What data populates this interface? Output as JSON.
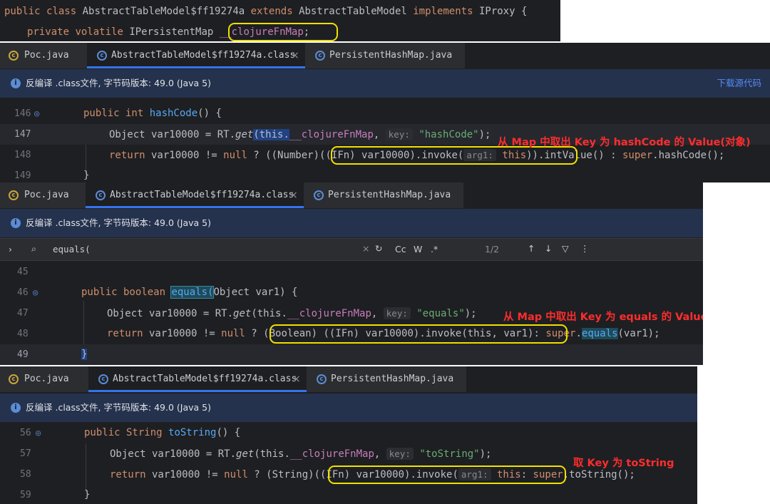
{
  "top_snippet": {
    "line1": {
      "kw1": "public",
      "kw2": "class",
      "cls": "AbstractTableModel$ff19274a",
      "kw3": "extends",
      "base": "AbstractTableModel",
      "kw4": "implements",
      "iface": "IProxy",
      "brace": "{"
    },
    "line2": {
      "kw1": "private",
      "kw2": "volatile",
      "type": "IPersistentMap",
      "field": "__clojureFnMap",
      "semi": ";"
    }
  },
  "tabs": [
    "Poc.java",
    "AbstractTableModel$ff19274a.class",
    "PersistentHashMap.java"
  ],
  "tab_close": "×",
  "infobar": {
    "label": "反编译 .class文件, 字节码版本: 49.0 (Java 5)",
    "link": "下载源代码",
    "icon": "i"
  },
  "search": {
    "query": "equals(",
    "count": "1/2",
    "opt_cc": "Cc",
    "opt_w": "W",
    "opt_regex": ".*"
  },
  "panel_a": {
    "lines": [
      {
        "num": "146",
        "text1": "public int ",
        "fn": "hashCode",
        "text2": "() {"
      },
      {
        "num": "147",
        "pre": "Object var10000 = RT.",
        "get": "get",
        "p1": "(this.",
        "fld": "__clojureFnMap",
        "p2": ", ",
        "hint": "key:",
        "str": "\"hashCode\"",
        "p3": ");"
      },
      {
        "num": "148",
        "pre": "return",
        "t1": " var10000 != ",
        "null": "null",
        "t2": " ? ((Number)",
        "hlA": "((IFn) var10000).invoke(",
        "hint": "arg1:",
        "this": "this",
        "hlB": "))",
        "t3": ".intValue() : ",
        "sup": "super",
        "t4": ".hashCode();"
      },
      {
        "num": "149",
        "text": "}"
      }
    ],
    "annotation": "从 Map 中取出 Key 为 hashCode 的 Value(对象)"
  },
  "panel_b": {
    "lines": [
      {
        "num": "45",
        "text": ""
      },
      {
        "num": "46",
        "kw": "public boolean ",
        "fn": "equals(",
        "t": "Object var1) {"
      },
      {
        "num": "47",
        "pre": "Object var10000 = RT.",
        "get": "get",
        "p1": "(this.",
        "fld": "__clojureFnMap",
        "p2": ", ",
        "hint": "key:",
        "str": "\"equals\"",
        "p3": ");"
      },
      {
        "num": "48",
        "pre": "return",
        "t1": " var10000 != ",
        "null": "null",
        "t2": " ? ",
        "hl": "(Boolean) ((IFn) var10000).invoke(this, var1)",
        "t3": ": ",
        "sup": "super",
        "t4": ".",
        "eq": "equals",
        "t5": "(var1);"
      },
      {
        "num": "49",
        "text": "}"
      }
    ],
    "annotation": "从 Map 中取出 Key 为 equals 的 Value (对象)"
  },
  "panel_c": {
    "lines": [
      {
        "num": "56",
        "kw": "public String ",
        "fn": "toString",
        "t": "() {"
      },
      {
        "num": "57",
        "pre": "Object var10000 = RT.",
        "get": "get",
        "p1": "(this.",
        "fld": "__clojureFnMap",
        "p2": ", ",
        "hint": "key:",
        "str": "\"toString\"",
        "p3": ");"
      },
      {
        "num": "58",
        "pre": "return",
        "t1": " var10000 != ",
        "null": "null",
        "t2": " ? (String)",
        "hl": "((IFn) var10000).invoke(",
        "hint": "arg1:",
        "this": "this",
        "t3": ": ",
        "sup": "super",
        "t4": ".toString();"
      },
      {
        "num": "59",
        "text": "}"
      }
    ],
    "annotation": "取 Key 为 toString"
  },
  "colors": {
    "editor_bg": "#1e1f22",
    "tab_bg": "#2b2d30",
    "infobar_bg": "#25324d",
    "highlight_box": "#f0e000",
    "annotation": "#ff2d2d"
  }
}
